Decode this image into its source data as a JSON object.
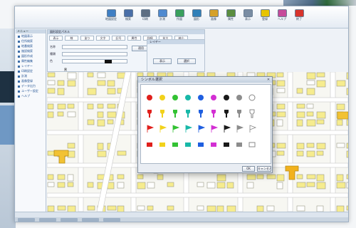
{
  "app": {
    "toolbar": {
      "buttons": [
        {
          "label": "地図設定",
          "icon": "map-settings-icon",
          "color": "#3f7fc4"
        },
        {
          "label": "検索",
          "icon": "search-icon",
          "color": "#4a6fa8"
        },
        {
          "label": "印刷",
          "icon": "print-icon",
          "color": "#5d6e82"
        },
        {
          "label": "計測",
          "icon": "measure-icon",
          "color": "#4f8ad0"
        },
        {
          "label": "作図",
          "icon": "draw-icon",
          "color": "#3aa05c"
        },
        {
          "label": "図形",
          "icon": "shape-icon",
          "color": "#2f7fb8"
        },
        {
          "label": "画像",
          "icon": "image-icon",
          "color": "#d6a128"
        },
        {
          "label": "属性",
          "icon": "attribute-icon",
          "color": "#5a8d3f"
        },
        {
          "label": "表示",
          "icon": "display-icon",
          "color": "#7a8da3"
        },
        {
          "label": "登録",
          "icon": "register-icon",
          "color": "#e7c400"
        },
        {
          "label": "ヘルプ",
          "icon": "help-icon",
          "color": "#c64b9a"
        },
        {
          "label": "終了",
          "icon": "exit-icon",
          "color": "#d8342c"
        }
      ]
    },
    "sidebar": {
      "header": "メニュー",
      "items": [
        "地図表示",
        "住所検索",
        "地番検索",
        "施設検索",
        "図形作成",
        "属性編集",
        "レイヤー",
        "印刷設定",
        "計測",
        "画像登録",
        "データ出力",
        "ユーザー設定",
        "ヘルプ"
      ]
    },
    "panel": {
      "title": "図形設定パネル",
      "tabs": [
        "表示",
        "線",
        "塗り",
        "文字",
        "記号",
        "属性",
        "詳細",
        "拡大",
        "縮小"
      ],
      "rows": [
        {
          "label": "名称",
          "value": ""
        },
        {
          "label": "種類",
          "value": ""
        },
        {
          "label": "色",
          "value": "黒"
        }
      ],
      "buttons": [
        "適用",
        "取消",
        "更新"
      ]
    },
    "panel2": {
      "title": "レイヤー",
      "buttons": [
        "表示",
        "選択"
      ]
    },
    "dialog": {
      "title": "シンボル選択",
      "colors": [
        "#e0201c",
        "#f2d21b",
        "#33c233",
        "#18b8a8",
        "#1f5fe0",
        "#d32fd3",
        "#1a1a1a",
        "#8c8c8c",
        "#ffffff"
      ],
      "rows": [
        "circle",
        "pin",
        "flag",
        "square"
      ],
      "ok_label": "OK",
      "cancel_label": "キャンセル"
    },
    "status": {
      "text": ""
    }
  }
}
